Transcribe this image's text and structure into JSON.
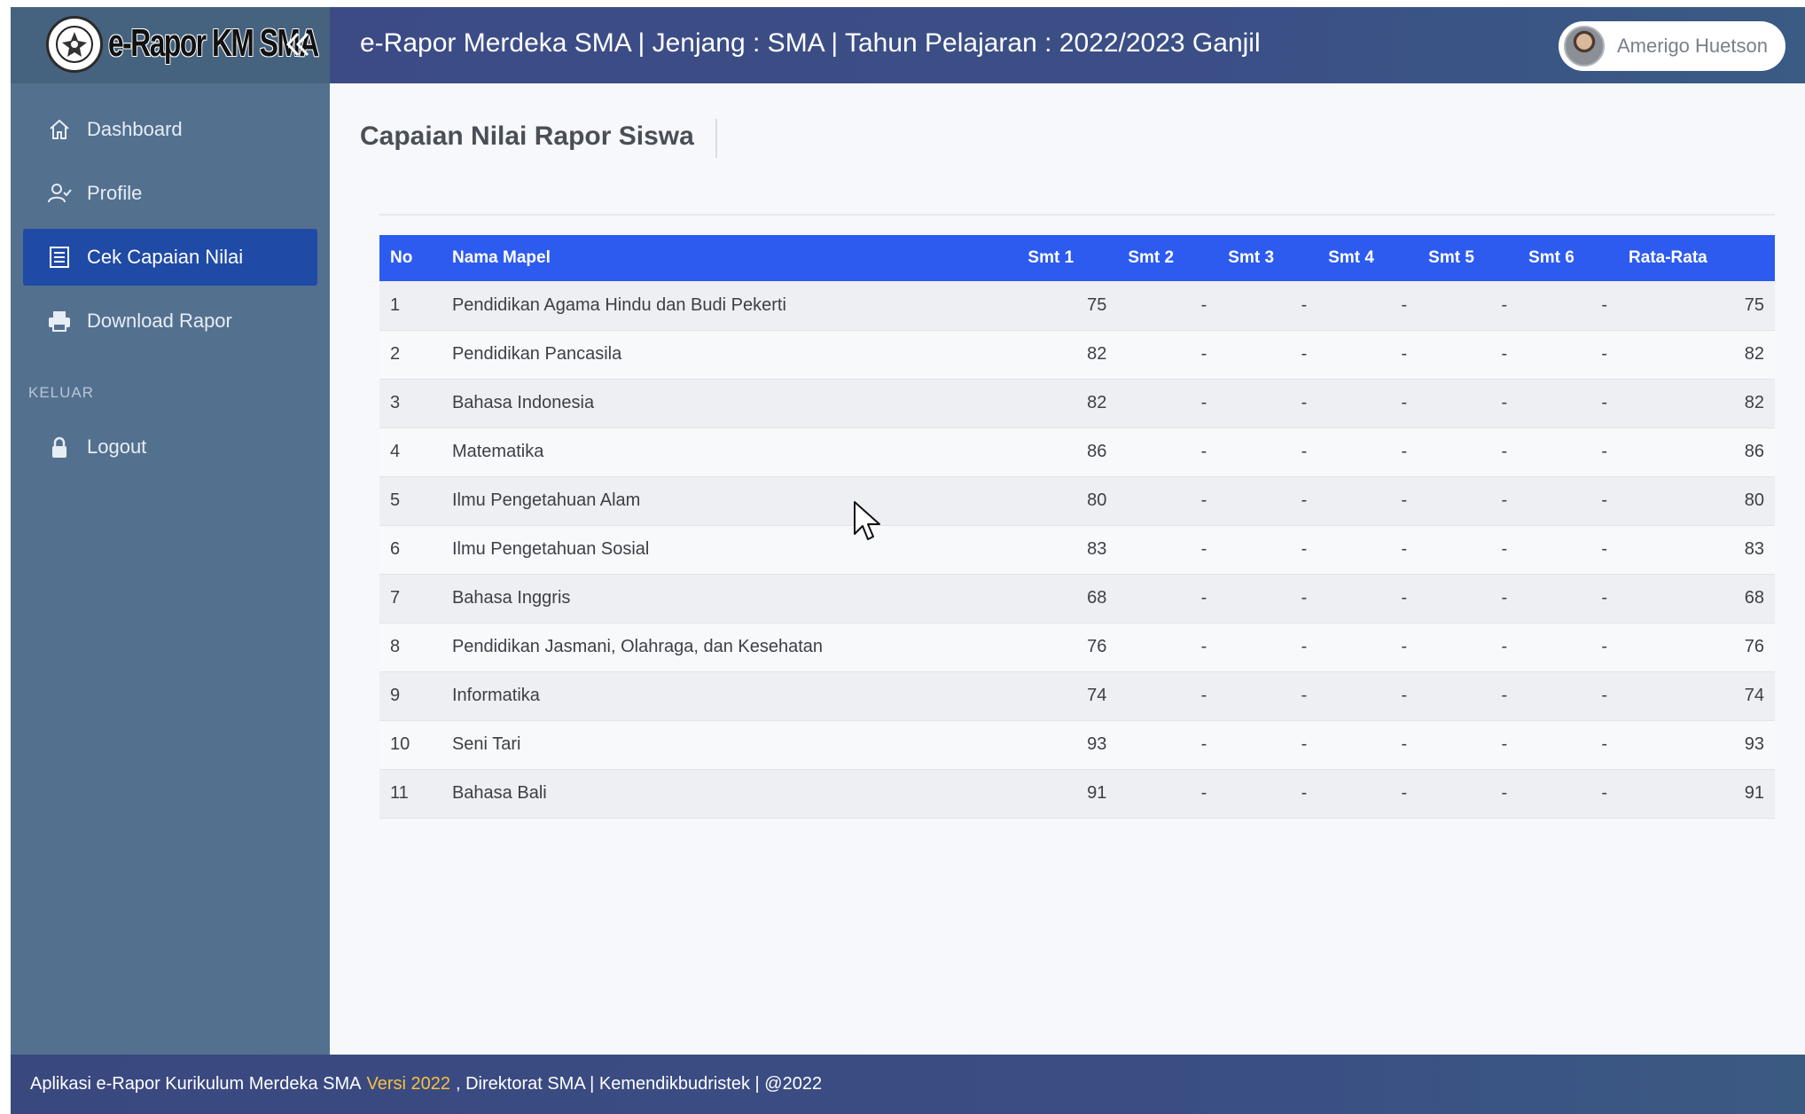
{
  "brand": {
    "name": "e-Rapor KM SMA",
    "collapse_icon": "double-chevron-left-icon"
  },
  "header": {
    "title": "e-Rapor Merdeka SMA | Jenjang : SMA | Tahun Pelajaran : 2022/2023 Ganjil",
    "user_name": "Amerigo Huetson"
  },
  "sidebar": {
    "items": [
      {
        "label": "Dashboard",
        "icon": "home-icon",
        "active": false
      },
      {
        "label": "Profile",
        "icon": "user-check-icon",
        "active": false
      },
      {
        "label": "Cek Capaian Nilai",
        "icon": "list-document-icon",
        "active": true
      },
      {
        "label": "Download Rapor",
        "icon": "printer-icon",
        "active": false
      }
    ],
    "section_label": "KELUAR",
    "logout": {
      "label": "Logout",
      "icon": "lock-icon"
    }
  },
  "main": {
    "page_title": "Capaian Nilai Rapor Siswa",
    "table": {
      "headers": [
        "No",
        "Nama Mapel",
        "Smt 1",
        "Smt 2",
        "Smt 3",
        "Smt 4",
        "Smt 5",
        "Smt 6",
        "Rata-Rata"
      ],
      "rows": [
        {
          "no": "1",
          "mapel": "Pendidikan Agama Hindu dan Budi Pekerti",
          "s1": "75",
          "s2": "-",
          "s3": "-",
          "s4": "-",
          "s5": "-",
          "s6": "-",
          "avg": "75"
        },
        {
          "no": "2",
          "mapel": "Pendidikan Pancasila",
          "s1": "82",
          "s2": "-",
          "s3": "-",
          "s4": "-",
          "s5": "-",
          "s6": "-",
          "avg": "82"
        },
        {
          "no": "3",
          "mapel": "Bahasa Indonesia",
          "s1": "82",
          "s2": "-",
          "s3": "-",
          "s4": "-",
          "s5": "-",
          "s6": "-",
          "avg": "82"
        },
        {
          "no": "4",
          "mapel": "Matematika",
          "s1": "86",
          "s2": "-",
          "s3": "-",
          "s4": "-",
          "s5": "-",
          "s6": "-",
          "avg": "86"
        },
        {
          "no": "5",
          "mapel": "Ilmu Pengetahuan Alam",
          "s1": "80",
          "s2": "-",
          "s3": "-",
          "s4": "-",
          "s5": "-",
          "s6": "-",
          "avg": "80"
        },
        {
          "no": "6",
          "mapel": "Ilmu Pengetahuan Sosial",
          "s1": "83",
          "s2": "-",
          "s3": "-",
          "s4": "-",
          "s5": "-",
          "s6": "-",
          "avg": "83"
        },
        {
          "no": "7",
          "mapel": "Bahasa Inggris",
          "s1": "68",
          "s2": "-",
          "s3": "-",
          "s4": "-",
          "s5": "-",
          "s6": "-",
          "avg": "68"
        },
        {
          "no": "8",
          "mapel": "Pendidikan Jasmani, Olahraga, dan Kesehatan",
          "s1": "76",
          "s2": "-",
          "s3": "-",
          "s4": "-",
          "s5": "-",
          "s6": "-",
          "avg": "76"
        },
        {
          "no": "9",
          "mapel": "Informatika",
          "s1": "74",
          "s2": "-",
          "s3": "-",
          "s4": "-",
          "s5": "-",
          "s6": "-",
          "avg": "74"
        },
        {
          "no": "10",
          "mapel": "Seni Tari",
          "s1": "93",
          "s2": "-",
          "s3": "-",
          "s4": "-",
          "s5": "-",
          "s6": "-",
          "avg": "93"
        },
        {
          "no": "11",
          "mapel": "Bahasa Bali",
          "s1": "91",
          "s2": "-",
          "s3": "-",
          "s4": "-",
          "s5": "-",
          "s6": "-",
          "avg": "91"
        }
      ]
    }
  },
  "footer": {
    "prefix": "Aplikasi e-Rapor Kurikulum Merdeka SMA",
    "version": "Versi 2022",
    "suffix": ", Direktorat SMA | Kemendikbudristek | @2022"
  },
  "colors": {
    "sidebar": "#54708f",
    "header": "#3c4b86",
    "table_header": "#2d5bf0",
    "active_nav": "#1f4aa6",
    "version_text": "#f5c242"
  }
}
